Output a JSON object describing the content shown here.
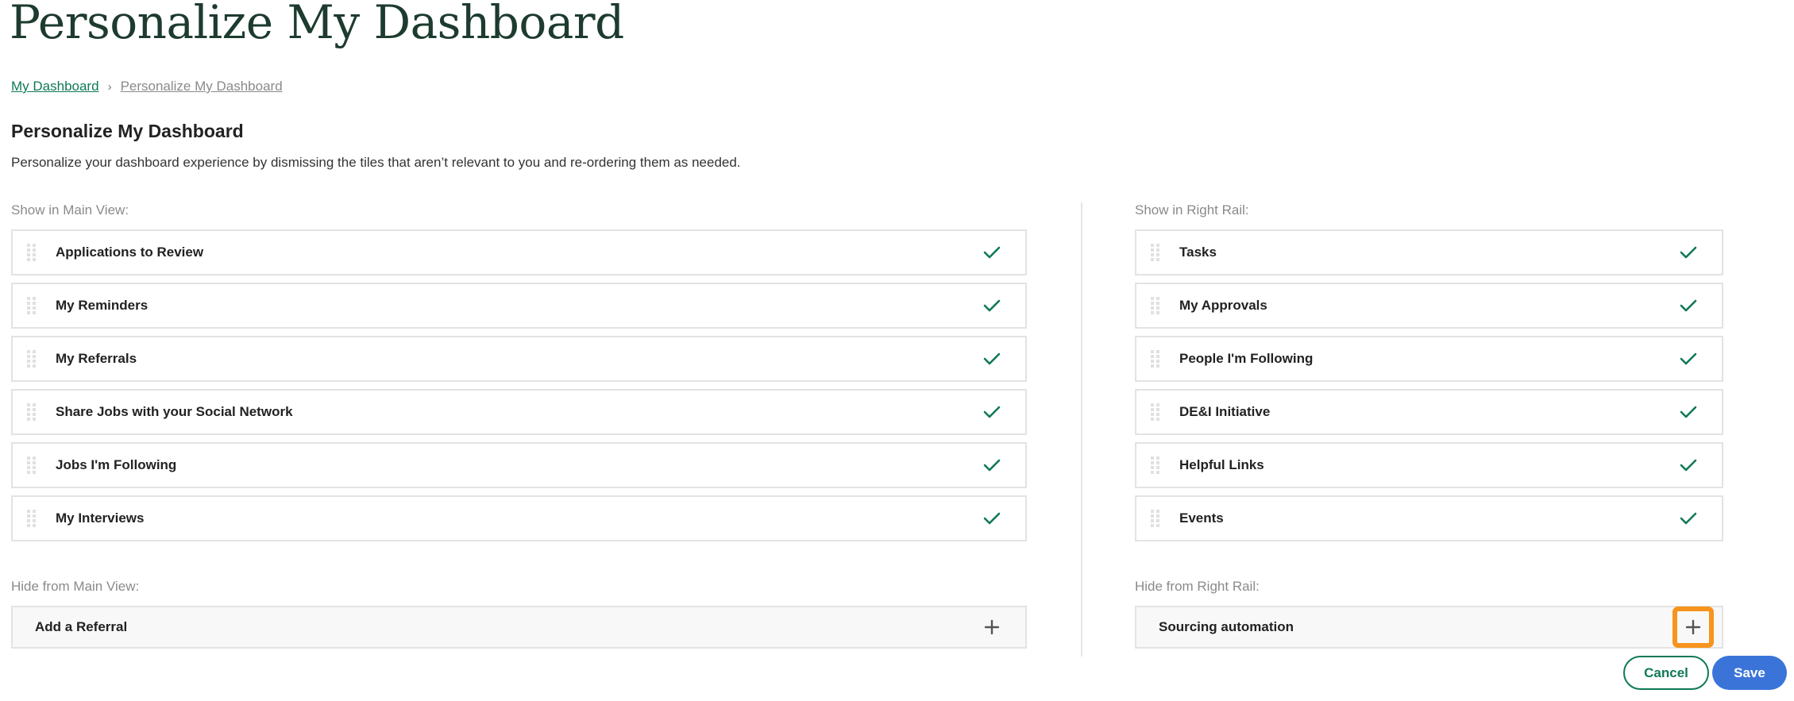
{
  "header": {
    "title": "Personalize My Dashboard"
  },
  "breadcrumb": {
    "items": [
      {
        "label": "My Dashboard"
      },
      {
        "label": "Personalize My Dashboard"
      }
    ],
    "separator": "›"
  },
  "section": {
    "title": "Personalize My Dashboard",
    "description": "Personalize your dashboard experience by dismissing the tiles that aren’t relevant to you and re-ordering them as needed."
  },
  "main_view": {
    "show_label": "Show in Main View:",
    "shown": [
      {
        "label": "Applications to Review",
        "icon": "check-icon"
      },
      {
        "label": "My Reminders",
        "icon": "check-icon"
      },
      {
        "label": "My Referrals",
        "icon": "check-icon"
      },
      {
        "label": "Share Jobs with your Social Network",
        "icon": "check-icon"
      },
      {
        "label": "Jobs I'm Following",
        "icon": "check-icon"
      },
      {
        "label": "My Interviews",
        "icon": "check-icon"
      }
    ],
    "hide_label": "Hide from Main View:",
    "hidden": [
      {
        "label": "Add a Referral",
        "icon": "plus-icon"
      }
    ]
  },
  "right_rail": {
    "show_label": "Show in Right Rail:",
    "shown": [
      {
        "label": "Tasks",
        "icon": "check-icon"
      },
      {
        "label": "My Approvals",
        "icon": "check-icon"
      },
      {
        "label": "People I'm Following",
        "icon": "check-icon"
      },
      {
        "label": "DE&I Initiative",
        "icon": "check-icon"
      },
      {
        "label": "Helpful Links",
        "icon": "check-icon"
      },
      {
        "label": "Events",
        "icon": "check-icon"
      }
    ],
    "hide_label": "Hide from Right Rail:",
    "hidden": [
      {
        "label": "Sourcing automation",
        "icon": "plus-icon",
        "highlighted": true
      }
    ]
  },
  "actions": {
    "cancel_label": "Cancel",
    "save_label": "Save"
  },
  "colors": {
    "title": "#1d3b2e",
    "link": "#0f7a53",
    "check": "#0f7a53",
    "plus": "#555555",
    "highlight": "#f7941d",
    "save_bg": "#3a74d9",
    "tile_border": "#e3e3e3",
    "hidden_tile_bg": "#f8f8f8"
  }
}
